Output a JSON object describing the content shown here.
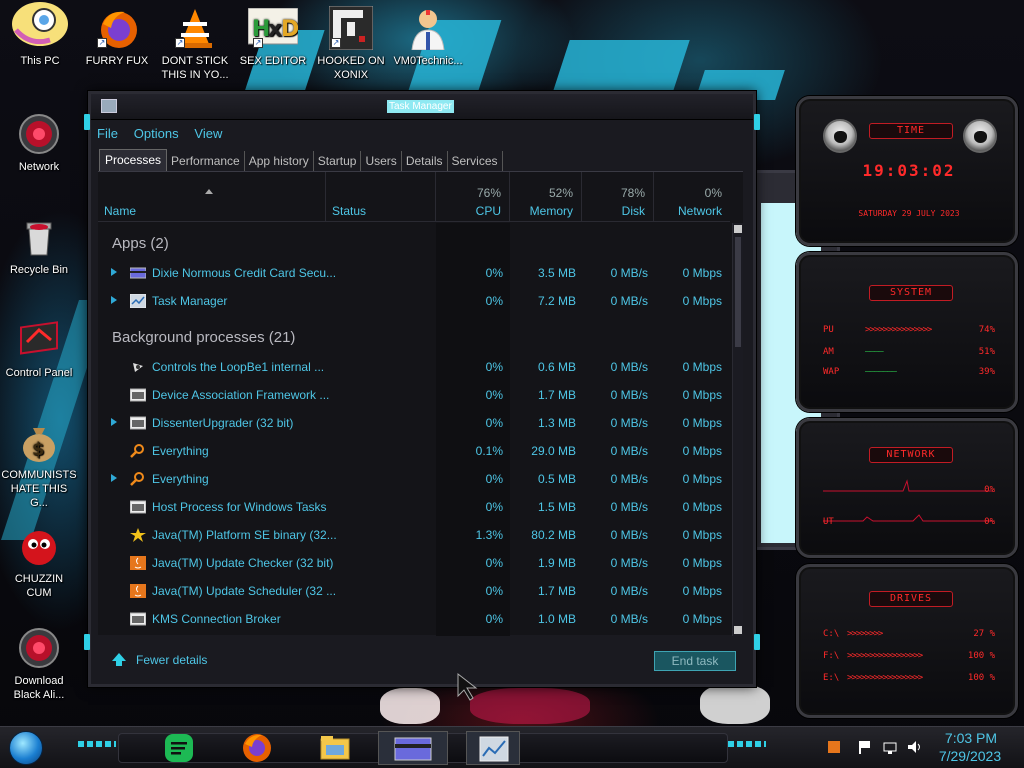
{
  "desktop": {
    "icons": [
      {
        "label": "This PC",
        "icon": "this-pc-icon"
      },
      {
        "label": "FURRY FUX",
        "icon": "firefox-icon"
      },
      {
        "label": "DONT STICK THIS IN YO...",
        "icon": "vlc-icon"
      },
      {
        "label": "SEX EDITOR",
        "icon": "hex-editor-icon"
      },
      {
        "label": "HOOKED ON XONIX",
        "icon": "xonix-game-icon"
      },
      {
        "label": "VM0Technic...",
        "icon": "doctor-icon"
      },
      {
        "label": "Network",
        "icon": "network-icon"
      },
      {
        "label": "Recycle Bin",
        "icon": "recycle-bin-icon"
      },
      {
        "label": "Control Panel",
        "icon": "control-panel-icon"
      },
      {
        "label": "COMMUNISTS HATE THIS G...",
        "icon": "money-bag-icon"
      },
      {
        "label": "CHUZZIN CUM",
        "icon": "chuzzle-icon"
      },
      {
        "label": "Download Black Ali...",
        "icon": "alienware-download-icon"
      }
    ]
  },
  "task_manager": {
    "title": "Task Manager",
    "menu": [
      "File",
      "Options",
      "View"
    ],
    "tabs": [
      "Processes",
      "Performance",
      "App history",
      "Startup",
      "Users",
      "Details",
      "Services"
    ],
    "active_tab": "Processes",
    "columns": {
      "name": "Name",
      "status": "Status",
      "cpu": {
        "label": "CPU",
        "percent": "76%"
      },
      "memory": {
        "label": "Memory",
        "percent": "52%"
      },
      "disk": {
        "label": "Disk",
        "percent": "78%"
      },
      "network": {
        "label": "Network",
        "percent": "0%"
      }
    },
    "groups": {
      "apps": "Apps (2)",
      "background": "Background processes (21)"
    },
    "apps": [
      {
        "name": "Dixie Normous Credit Card Secu...",
        "cpu": "0%",
        "memory": "3.5 MB",
        "disk": "0 MB/s",
        "network": "0 Mbps",
        "icon": "card-app-icon"
      },
      {
        "name": "Task Manager",
        "cpu": "0%",
        "memory": "7.2 MB",
        "disk": "0 MB/s",
        "network": "0 Mbps",
        "icon": "task-manager-icon"
      }
    ],
    "background": [
      {
        "name": "Controls the LoopBe1 internal ...",
        "cpu": "0%",
        "memory": "0.6 MB",
        "disk": "0 MB/s",
        "network": "0 Mbps",
        "expand": false,
        "icon": "loopbe-icon"
      },
      {
        "name": "Device Association Framework ...",
        "cpu": "0%",
        "memory": "1.7 MB",
        "disk": "0 MB/s",
        "network": "0 Mbps",
        "expand": false,
        "icon": "window-icon"
      },
      {
        "name": "DissenterUpgrader (32 bit)",
        "cpu": "0%",
        "memory": "1.3 MB",
        "disk": "0 MB/s",
        "network": "0 Mbps",
        "expand": true,
        "icon": "window-icon"
      },
      {
        "name": "Everything",
        "cpu": "0.1%",
        "memory": "29.0 MB",
        "disk": "0 MB/s",
        "network": "0 Mbps",
        "expand": false,
        "icon": "magnifier-icon"
      },
      {
        "name": "Everything",
        "cpu": "0%",
        "memory": "0.5 MB",
        "disk": "0 MB/s",
        "network": "0 Mbps",
        "expand": true,
        "icon": "magnifier-icon"
      },
      {
        "name": "Host Process for Windows Tasks",
        "cpu": "0%",
        "memory": "1.5 MB",
        "disk": "0 MB/s",
        "network": "0 Mbps",
        "expand": false,
        "icon": "window-icon"
      },
      {
        "name": "Java(TM) Platform SE binary (32...",
        "cpu": "1.3%",
        "memory": "80.2 MB",
        "disk": "0 MB/s",
        "network": "0 Mbps",
        "expand": false,
        "icon": "java-star-icon"
      },
      {
        "name": "Java(TM) Update Checker (32 bit)",
        "cpu": "0%",
        "memory": "1.9 MB",
        "disk": "0 MB/s",
        "network": "0 Mbps",
        "expand": false,
        "icon": "java-icon"
      },
      {
        "name": "Java(TM) Update Scheduler (32 ...",
        "cpu": "0%",
        "memory": "1.7 MB",
        "disk": "0 MB/s",
        "network": "0 Mbps",
        "expand": false,
        "icon": "java-icon"
      },
      {
        "name": "KMS Connection Broker",
        "cpu": "0%",
        "memory": "1.0 MB",
        "disk": "0 MB/s",
        "network": "0 Mbps",
        "expand": false,
        "icon": "window-icon"
      }
    ],
    "fewer_details": "Fewer details",
    "end_task": "End task"
  },
  "widgets": {
    "time": {
      "title": "TIME",
      "clock": "19:03:02",
      "date": "SATURDAY 29 JULY 2023"
    },
    "system": {
      "title": "SYSTEM",
      "rows": [
        {
          "label": "PU",
          "value": "74%"
        },
        {
          "label": "AM",
          "value": "51%"
        },
        {
          "label": "WAP",
          "value": "39%"
        }
      ]
    },
    "network": {
      "title": "NETWORK",
      "rows": [
        {
          "label": "",
          "value": "0%"
        },
        {
          "label": "UT",
          "value": "0%"
        }
      ]
    },
    "drives": {
      "title": "DRIVES",
      "rows": [
        {
          "label": "C:\\",
          "value": "27 %"
        },
        {
          "label": "F:\\",
          "value": "100 %"
        },
        {
          "label": "E:\\",
          "value": "100 %"
        }
      ]
    }
  },
  "taskbar": {
    "pinned": [
      "spotify-icon",
      "firefox-icon",
      "file-explorer-icon",
      "card-app-icon",
      "task-manager-icon"
    ],
    "tray_icons": [
      "shield-flag-icon",
      "flag-icon",
      "network-tray-icon",
      "volume-icon"
    ],
    "time": "7:03 PM",
    "date": "7/29/2023"
  },
  "colors": {
    "accent_cyan": "#4ec6e6",
    "widget_red": "#ff2a2a"
  }
}
